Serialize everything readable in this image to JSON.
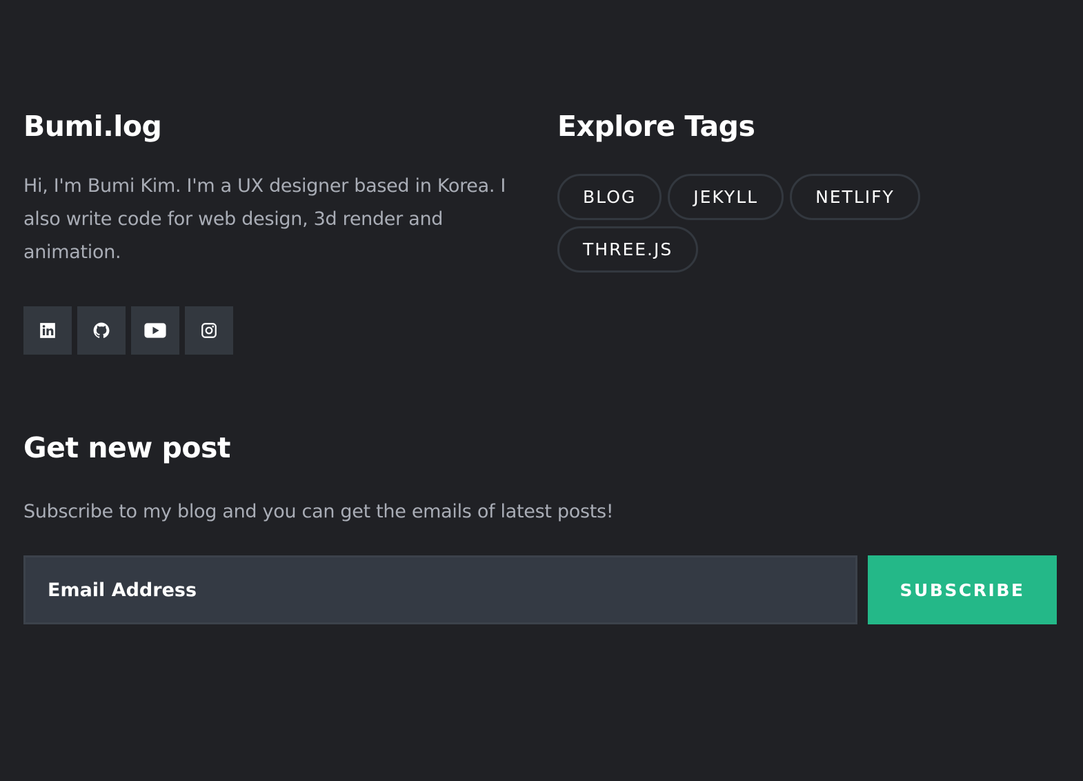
{
  "about": {
    "title": "Bumi.log",
    "description": "Hi, I'm Bumi Kim. I'm a UX designer based in Korea. I also write code for web design, 3d render and animation."
  },
  "socials": [
    {
      "name": "linkedin",
      "icon": "linkedin-icon"
    },
    {
      "name": "github",
      "icon": "github-icon"
    },
    {
      "name": "youtube",
      "icon": "youtube-icon"
    },
    {
      "name": "instagram",
      "icon": "instagram-icon"
    }
  ],
  "tags": {
    "title": "Explore Tags",
    "items": [
      "BLOG",
      "JEKYLL",
      "NETLIFY",
      "THREE.JS"
    ]
  },
  "subscribe": {
    "title": "Get new post",
    "description": "Subscribe to my blog and you can get the emails of latest posts!",
    "email_placeholder": "Email Address",
    "button_label": "SUBSCRIBE"
  },
  "colors": {
    "background": "#202125",
    "accent": "#24b888",
    "surface": "#33383f",
    "muted_text": "#a9adb6"
  }
}
